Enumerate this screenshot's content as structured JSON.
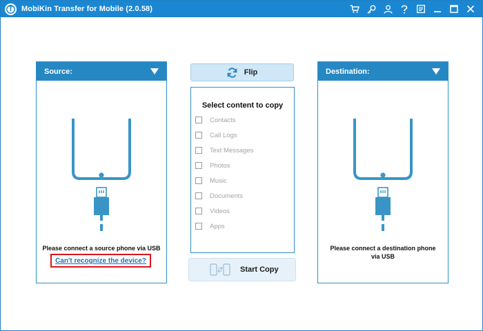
{
  "window": {
    "title": "MobiKin Transfer for Mobile  (2.0.58)",
    "logo_letter": "T",
    "accent": "#1b87d2"
  },
  "titlebar_icons": [
    "cart-icon",
    "key-icon",
    "account-icon",
    "help-icon",
    "feedback-icon",
    "minimize-icon",
    "maximize-icon",
    "close-icon"
  ],
  "source": {
    "header": "Source:",
    "message": "Please connect a source phone via USB",
    "link": "Can't recognize the device?"
  },
  "destination": {
    "header": "Destination:",
    "message_line1": "Please connect a destination phone",
    "message_line2": "via USB"
  },
  "flip": {
    "label": "Flip"
  },
  "content": {
    "title": "Select content to copy",
    "options": [
      "Contacts",
      "Call Logs",
      "Text Messages",
      "Photos",
      "Music",
      "Documents",
      "Videos",
      "Apps"
    ]
  },
  "start_copy": {
    "label": "Start Copy"
  }
}
